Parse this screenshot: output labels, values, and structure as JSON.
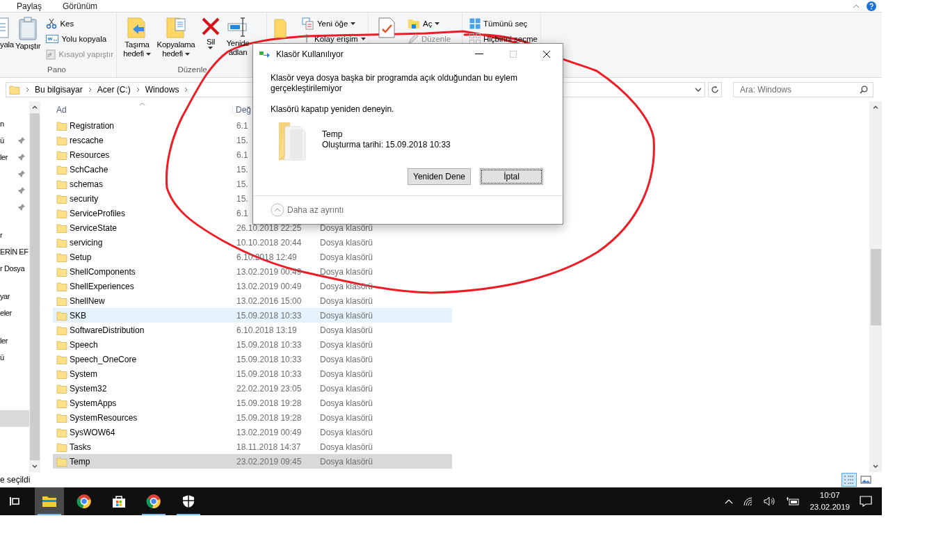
{
  "ribbon_tabs": [
    {
      "label": "Paylaş"
    },
    {
      "label": "Görünüm"
    }
  ],
  "ribbon_groups": [
    {
      "label": "Pano",
      "buttons": [
        {
          "kind": "large",
          "lines": [
            "yala"
          ]
        },
        {
          "kind": "large",
          "lines": [
            "Yapıştır"
          ]
        },
        {
          "kind": "small",
          "label": "Kes",
          "disabled": false
        },
        {
          "kind": "small",
          "label": "Yolu kopyala",
          "disabled": false
        },
        {
          "kind": "small",
          "label": "Kısayol yapıştır",
          "disabled": true
        }
      ]
    },
    {
      "label": "Düzenle",
      "buttons": [
        {
          "kind": "large",
          "lines": [
            "Taşıma",
            "hedefi"
          ],
          "menu": true
        },
        {
          "kind": "large",
          "lines": [
            "Kopyalama",
            "hedefi"
          ],
          "menu": true
        },
        {
          "kind": "large",
          "lines": [
            "Sil"
          ],
          "menu": true
        },
        {
          "kind": "large",
          "lines": [
            "Yenide",
            "adlan"
          ],
          "menu": false
        }
      ]
    },
    {
      "buttons": [
        {
          "kind": "large"
        },
        {
          "kind": "small",
          "label": "Yeni öğe",
          "menu": true,
          "disabled": false
        },
        {
          "kind": "small",
          "label": "Kolay erişim",
          "menu": true,
          "disabled": false
        }
      ]
    },
    {
      "buttons": [
        {
          "kind": "large"
        },
        {
          "kind": "small",
          "label": "Aç",
          "menu": true,
          "disabled": false
        },
        {
          "kind": "small",
          "label": "Düzenle",
          "menu": false,
          "disabled": true
        }
      ]
    },
    {
      "buttons": [
        {
          "kind": "small",
          "label": "Tümünü seç",
          "disabled": false
        },
        {
          "kind": "small",
          "label": "Hiçbirini seçme",
          "disabled": false
        }
      ]
    }
  ],
  "address": {
    "crumbs": [
      "Bu bilgisayar",
      "Acer (C:)",
      "Windows"
    ],
    "search_placeholder": "Ara: Windows"
  },
  "nav_groups": [
    [
      {
        "label": "n",
        "pinned": false,
        "selected": false
      },
      {
        "label": "ü",
        "pinned": true,
        "selected": false
      },
      {
        "label": "ler",
        "pinned": true,
        "selected": false
      },
      {
        "pinned": true,
        "selected": false
      },
      {
        "pinned": true,
        "selected": false
      },
      {
        "pinned": true,
        "selected": false
      }
    ],
    [
      {
        "label": "r",
        "pinned": false,
        "selected": false
      },
      {
        "label": "ERİN EF",
        "pinned": false,
        "selected": false
      },
      {
        "label": "r Dosya",
        "pinned": false,
        "selected": false
      }
    ],
    [
      {
        "label": "yar",
        "pinned": false,
        "selected": false
      },
      {
        "label": "eler",
        "pinned": false,
        "selected": false
      }
    ],
    [
      {
        "label": "ler",
        "pinned": false,
        "selected": false
      },
      {
        "label": "ü",
        "pinned": false,
        "selected": false
      }
    ],
    [
      {
        "pinned": false,
        "selected": true
      }
    ]
  ],
  "columns": [
    "Ad",
    "Değ"
  ],
  "rows": [
    {
      "name": "Registration",
      "date": "6.1",
      "selected": false,
      "hovered": false
    },
    {
      "name": "rescache",
      "date": "15.",
      "selected": false,
      "hovered": false
    },
    {
      "name": "Resources",
      "date": "6.1",
      "selected": false,
      "hovered": false
    },
    {
      "name": "SchCache",
      "date": "15.",
      "selected": false,
      "hovered": false
    },
    {
      "name": "schemas",
      "date": "15.",
      "selected": false,
      "hovered": false
    },
    {
      "name": "security",
      "date": "15.",
      "selected": false,
      "hovered": false
    },
    {
      "name": "ServiceProfiles",
      "date": "6.1",
      "selected": false,
      "hovered": false
    },
    {
      "name": "ServiceState",
      "date": "26.10.2018 22:25",
      "type": "Dosya klasörü",
      "selected": false,
      "hovered": false
    },
    {
      "name": "servicing",
      "date": "10.10.2018 20:44",
      "type": "Dosya klasörü",
      "selected": false,
      "hovered": false
    },
    {
      "name": "Setup",
      "date": "6.10.2018 12:49",
      "type": "Dosya klasörü",
      "selected": false,
      "hovered": false
    },
    {
      "name": "ShellComponents",
      "date": "13.02.2019 00:49",
      "type": "Dosya klasörü",
      "selected": false,
      "hovered": false
    },
    {
      "name": "ShellExperiences",
      "date": "13.02.2019 00:49",
      "type": "Dosya klasörü",
      "selected": false,
      "hovered": false
    },
    {
      "name": "ShellNew",
      "date": "13.02.2016 15:00",
      "type": "Dosya klasörü",
      "selected": false,
      "hovered": false
    },
    {
      "name": "SKB",
      "date": "15.09.2018 10:33",
      "type": "Dosya klasörü",
      "selected": false,
      "hovered": true
    },
    {
      "name": "SoftwareDistribution",
      "date": "6.10.2018 13:19",
      "type": "Dosya klasörü",
      "selected": false,
      "hovered": false
    },
    {
      "name": "Speech",
      "date": "15.09.2018 10:33",
      "type": "Dosya klasörü",
      "selected": false,
      "hovered": false
    },
    {
      "name": "Speech_OneCore",
      "date": "15.09.2018 10:33",
      "type": "Dosya klasörü",
      "selected": false,
      "hovered": false
    },
    {
      "name": "System",
      "date": "15.09.2018 10:33",
      "type": "Dosya klasörü",
      "selected": false,
      "hovered": false
    },
    {
      "name": "System32",
      "date": "22.02.2019 23:05",
      "type": "Dosya klasörü",
      "selected": false,
      "hovered": false
    },
    {
      "name": "SystemApps",
      "date": "15.09.2018 19:28",
      "type": "Dosya klasörü",
      "selected": false,
      "hovered": false
    },
    {
      "name": "SystemResources",
      "date": "15.09.2018 19:28",
      "type": "Dosya klasörü",
      "selected": false,
      "hovered": false
    },
    {
      "name": "SysWOW64",
      "date": "13.02.2019 00:49",
      "type": "Dosya klasörü",
      "selected": false,
      "hovered": false
    },
    {
      "name": "Tasks",
      "date": "18.11.2018 14:37",
      "type": "Dosya klasörü",
      "selected": false,
      "hovered": false
    },
    {
      "name": "Temp",
      "date": "23.02.2019 09:45",
      "type": "Dosya klasörü",
      "selected": true,
      "hovered": false
    }
  ],
  "status_bar": {
    "text": "e seçildi",
    "views": [
      {
        "selected": true
      },
      {
        "selected": false
      }
    ]
  },
  "dialog": {
    "title": "Klasör Kullanılıyor",
    "message": "Klasör veya dosya başka bir programda açık olduğundan bu eylem gerçekleştirilemiyor",
    "hint": "Klasörü kapatıp yeniden deneyin.",
    "item_name": "Temp",
    "item_detail": "Oluşturma tarihi: 15.09.2018 10:33",
    "buttons": [
      {
        "label": "Yeniden Dene",
        "focused": false
      },
      {
        "label": "İptal",
        "focused": true
      }
    ],
    "details_toggle": "Daha az ayrıntı"
  },
  "taskbar": {
    "apps": [
      {
        "running": false,
        "active": false
      },
      {
        "running": true,
        "active": true
      },
      {
        "running": false,
        "active": false
      },
      {
        "running": false,
        "active": false
      },
      {
        "running": true,
        "active": false
      },
      {
        "running": true,
        "active": false
      }
    ],
    "time": "10:07",
    "date": "23.02.2019"
  }
}
